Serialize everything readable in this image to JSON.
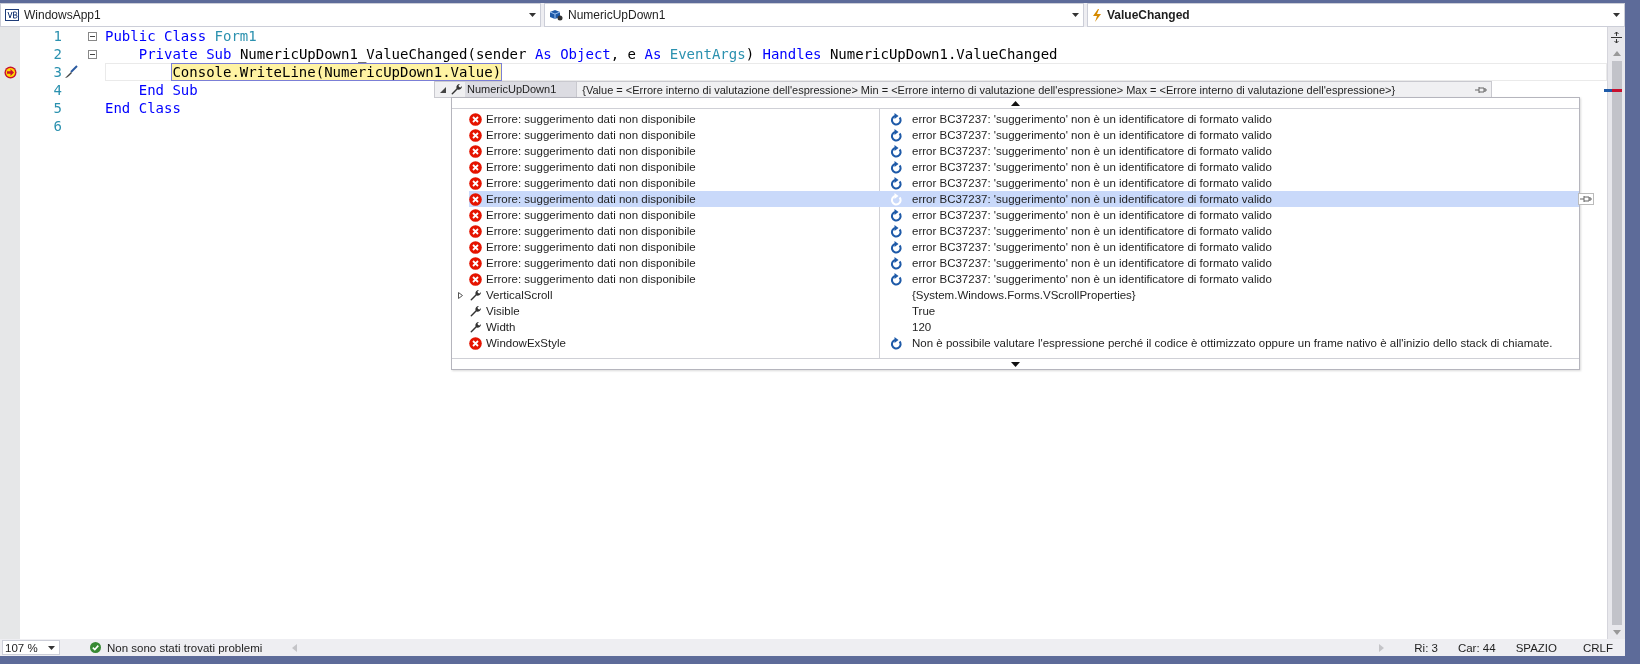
{
  "nav_bar": [
    {
      "kind": "project",
      "text": "WindowsApp1"
    },
    {
      "kind": "object",
      "text": "NumericUpDown1"
    },
    {
      "kind": "event",
      "text": "ValueChanged"
    }
  ],
  "code_lines": [
    {
      "number": "1",
      "expanded": true,
      "current": false,
      "tokens": [
        {
          "text": "Public Class ",
          "kind": "keyword"
        },
        {
          "text": "Form1",
          "kind": "type"
        }
      ]
    },
    {
      "number": "2",
      "expanded": true,
      "current": false,
      "tokens": [
        {
          "text": "    Private Sub ",
          "kind": "keyword"
        },
        {
          "text": "NumericUpDown1_ValueChanged(sender ",
          "kind": "plain"
        },
        {
          "text": "As Object",
          "kind": "keyword"
        },
        {
          "text": ", e ",
          "kind": "plain"
        },
        {
          "text": "As ",
          "kind": "keyword"
        },
        {
          "text": "EventArgs",
          "kind": "type"
        },
        {
          "text": ") ",
          "kind": "plain"
        },
        {
          "text": "Handles ",
          "kind": "keyword"
        },
        {
          "text": "NumericUpDown1.ValueChanged",
          "kind": "plain"
        }
      ]
    },
    {
      "number": "3",
      "current": true,
      "tokens": [
        {
          "text": "        Console.WriteLine(NumericUpDown1.Value)",
          "kind": "plain"
        }
      ]
    },
    {
      "number": "4",
      "current": false,
      "tokens": [
        {
          "text": "    End Sub",
          "kind": "keyword"
        }
      ]
    },
    {
      "number": "5",
      "current": false,
      "tokens": [
        {
          "text": "End Class",
          "kind": "keyword"
        }
      ]
    },
    {
      "number": "6"
    }
  ],
  "datatip": {
    "name": "NumericUpDown1",
    "value": "{Value = <Errore interno di valutazione dell'espressione> Min = <Errore interno di valutazione dell'espressione> Max = <Errore interno di valutazione dell'espressione>}",
    "expanded": true,
    "members": [
      {
        "name": "Errore: suggerimento dati non disponibile",
        "kind": "error",
        "value": "error BC37237: 'suggerimento' non è un identificatore di formato valido",
        "refresh": true,
        "selected": false
      },
      {
        "name": "Errore: suggerimento dati non disponibile",
        "kind": "error",
        "value": "error BC37237: 'suggerimento' non è un identificatore di formato valido",
        "refresh": true,
        "selected": false
      },
      {
        "name": "Errore: suggerimento dati non disponibile",
        "kind": "error",
        "value": "error BC37237: 'suggerimento' non è un identificatore di formato valido",
        "refresh": true,
        "selected": false
      },
      {
        "name": "Errore: suggerimento dati non disponibile",
        "kind": "error",
        "value": "error BC37237: 'suggerimento' non è un identificatore di formato valido",
        "refresh": true,
        "selected": false
      },
      {
        "name": "Errore: suggerimento dati non disponibile",
        "kind": "error",
        "value": "error BC37237: 'suggerimento' non è un identificatore di formato valido",
        "refresh": true,
        "selected": false
      },
      {
        "name": "Errore: suggerimento dati non disponibile",
        "kind": "error",
        "value": "error BC37237: 'suggerimento' non è un identificatore di formato valido",
        "refresh": true,
        "selected": true
      },
      {
        "name": "Errore: suggerimento dati non disponibile",
        "kind": "error",
        "value": "error BC37237: 'suggerimento' non è un identificatore di formato valido",
        "refresh": true,
        "selected": false
      },
      {
        "name": "Errore: suggerimento dati non disponibile",
        "kind": "error",
        "value": "error BC37237: 'suggerimento' non è un identificatore di formato valido",
        "refresh": true,
        "selected": false
      },
      {
        "name": "Errore: suggerimento dati non disponibile",
        "kind": "error",
        "value": "error BC37237: 'suggerimento' non è un identificatore di formato valido",
        "refresh": true,
        "selected": false
      },
      {
        "name": "Errore: suggerimento dati non disponibile",
        "kind": "error",
        "value": "error BC37237: 'suggerimento' non è un identificatore di formato valido",
        "refresh": true,
        "selected": false
      },
      {
        "name": "Errore: suggerimento dati non disponibile",
        "kind": "error",
        "value": "error BC37237: 'suggerimento' non è un identificatore di formato valido",
        "refresh": true,
        "selected": false
      },
      {
        "name": "VerticalScroll",
        "kind": "property",
        "expanded": false,
        "value": "{System.Windows.Forms.VScrollProperties}",
        "refresh": false,
        "selected": false
      },
      {
        "name": "Visible",
        "kind": "property",
        "value": "True",
        "refresh": false,
        "selected": false
      },
      {
        "name": "Width",
        "kind": "property",
        "value": "120",
        "refresh": false,
        "selected": false
      },
      {
        "name": "WindowExStyle",
        "kind": "error",
        "value": "Non è possibile valutare l'espressione perché il codice è ottimizzato oppure un frame nativo è all'inizio dello stack di chiamate.",
        "refresh": true,
        "selected": false
      }
    ]
  },
  "status_bar": {
    "zoom": "107 %",
    "issues": "Non sono stati trovati problemi",
    "line": "Ri: 3",
    "column": "Car: 44",
    "whitespace": "SPAZIO",
    "line_ending": "CRLF"
  }
}
